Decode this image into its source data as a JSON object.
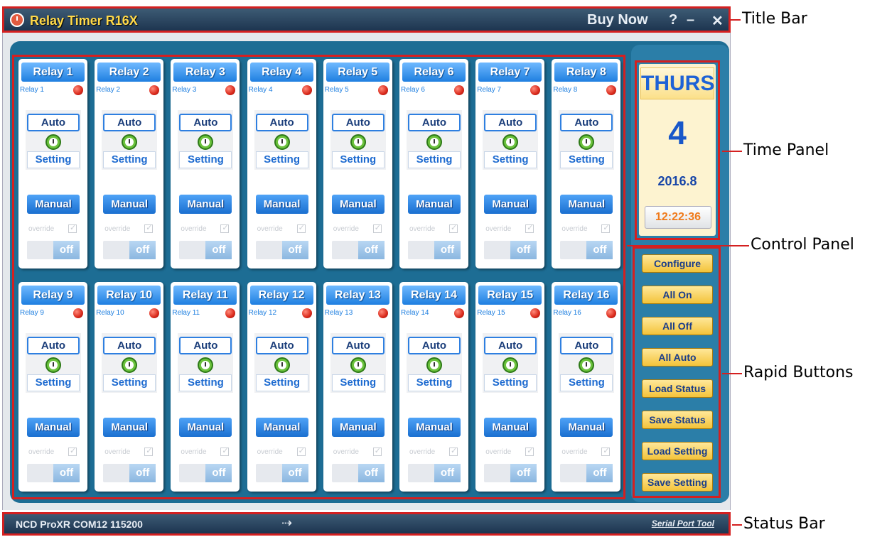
{
  "window": {
    "title": "Relay Timer R16X",
    "buy_now": "Buy Now",
    "help": "?",
    "minimize": "–",
    "close": "✕"
  },
  "relays": [
    {
      "label": "Relay 1",
      "sub": "Relay 1"
    },
    {
      "label": "Relay 2",
      "sub": "Relay 2"
    },
    {
      "label": "Relay 3",
      "sub": "Relay 3"
    },
    {
      "label": "Relay 4",
      "sub": "Relay 4"
    },
    {
      "label": "Relay 5",
      "sub": "Relay 5"
    },
    {
      "label": "Relay 6",
      "sub": "Relay 6"
    },
    {
      "label": "Relay 7",
      "sub": "Relay 7"
    },
    {
      "label": "Relay 8",
      "sub": "Relay 8"
    },
    {
      "label": "Relay 9",
      "sub": "Relay 9"
    },
    {
      "label": "Relay 10",
      "sub": "Relay 10"
    },
    {
      "label": "Relay 11",
      "sub": "Relay 11"
    },
    {
      "label": "Relay 12",
      "sub": "Relay 12"
    },
    {
      "label": "Relay 13",
      "sub": "Relay 13"
    },
    {
      "label": "Relay 14",
      "sub": "Relay 14"
    },
    {
      "label": "Relay 15",
      "sub": "Relay 15"
    },
    {
      "label": "Relay 16",
      "sub": "Relay 16"
    }
  ],
  "relay_controls": {
    "auto": "Auto",
    "setting": "Setting",
    "manual": "Manual",
    "override": "override",
    "toggle_state": "off"
  },
  "time_panel": {
    "day": "THURS",
    "date": "4",
    "year_month": "2016.8",
    "time": "12:22:36"
  },
  "rapid_buttons": [
    "Configure",
    "All On",
    "All Off",
    "All Auto",
    "Load Status",
    "Save Status",
    "Load Setting",
    "Save Setting"
  ],
  "status_bar": {
    "text": "NCD ProXR COM12 115200",
    "arrow": "⇢",
    "tool": "Serial Port Tool"
  },
  "annotations": {
    "title_bar": "Title Bar",
    "time_panel": "Time Panel",
    "control_panel": "Control Panel",
    "rapid_buttons": "Rapid Buttons",
    "status_bar": "Status Bar"
  },
  "colors": {
    "annotation_red": "#d42020",
    "relay_header_blue": "#1e7fe0",
    "rapid_button_gold": "#f3c33a",
    "led_red": "#d9281a"
  }
}
